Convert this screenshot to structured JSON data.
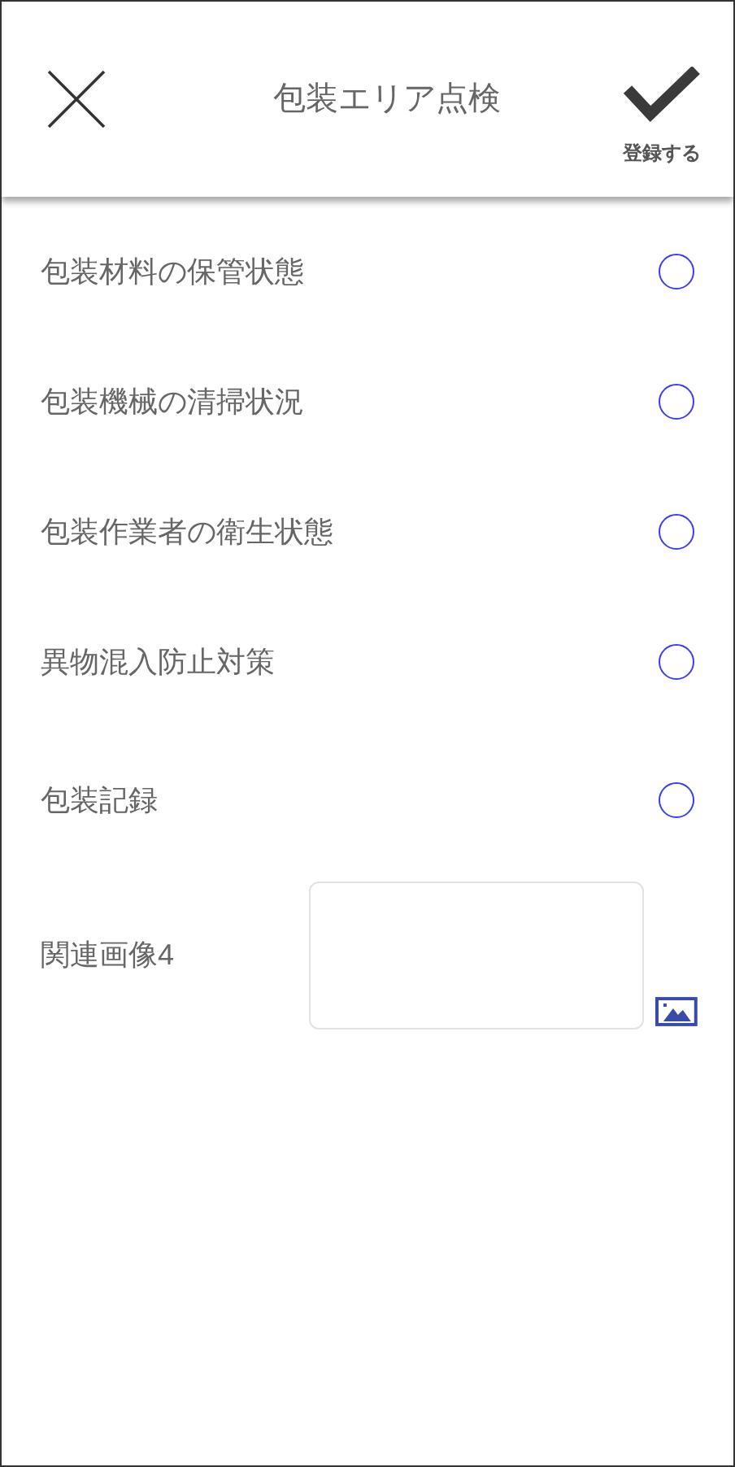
{
  "header": {
    "title": "包装エリア点検",
    "save_label": "登録する"
  },
  "items": [
    {
      "kind": "radio",
      "label": "包装材料の保管状態",
      "selected": false
    },
    {
      "kind": "radio",
      "label": "包装機械の清掃状況",
      "selected": false
    },
    {
      "kind": "radio",
      "label": "包装作業者の衛生状態",
      "selected": false
    },
    {
      "kind": "radio",
      "label": "異物混入防止対策",
      "selected": false
    },
    {
      "kind": "radio",
      "label": "包装記録",
      "selected": false
    },
    {
      "kind": "image",
      "label": "関連画像4"
    }
  ]
}
